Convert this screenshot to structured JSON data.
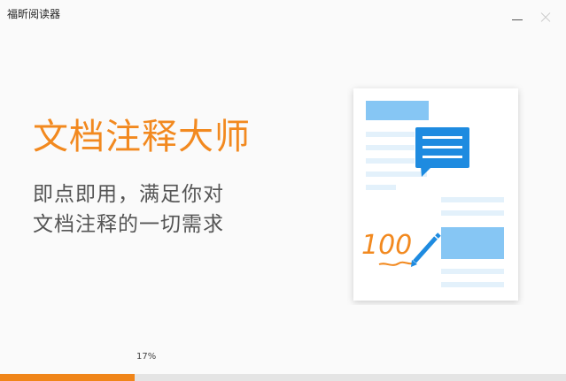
{
  "window": {
    "title": "福昕阅读器",
    "minimize_icon": "minimize-icon",
    "close_icon": "close-icon"
  },
  "splash": {
    "headline": "文档注释大师",
    "subline_1": "即点即用，满足你对",
    "subline_2": "文档注释的一切需求",
    "illustration_note_text": "100",
    "icons": [
      "document-icon",
      "comment-bubble-icon",
      "pen-icon"
    ]
  },
  "progress": {
    "label": "17%",
    "value": 0.238
  },
  "colors": {
    "accent": "#f2891f",
    "progress_fill": "#f08519",
    "blue": "#1e8be0",
    "light_blue": "#86c6f4"
  }
}
